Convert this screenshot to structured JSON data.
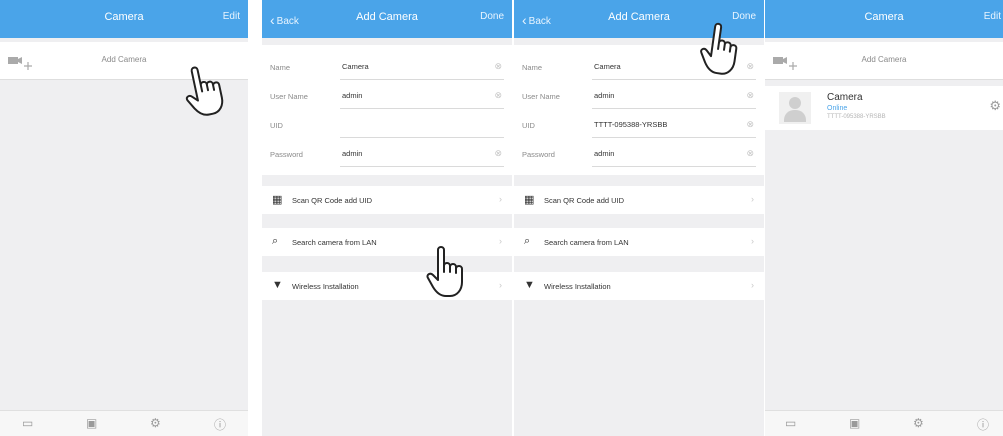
{
  "screen1": {
    "nav": {
      "title": "Camera",
      "edit": "Edit"
    },
    "add_camera_label": "Add Camera"
  },
  "screen2": {
    "nav": {
      "back": "Back",
      "title": "Add Camera",
      "done": "Done"
    },
    "form": [
      {
        "label": "Name",
        "value": "Camera"
      },
      {
        "label": "User Name",
        "value": "admin"
      },
      {
        "label": "UID",
        "value": ""
      },
      {
        "label": "Password",
        "value": "admin"
      }
    ],
    "options": [
      {
        "icon": "qr-code-icon",
        "label": "Scan QR Code add UID"
      },
      {
        "icon": "search-icon",
        "label": "Search camera from LAN"
      },
      {
        "icon": "wifi-icon",
        "label": "Wireless Installation"
      }
    ]
  },
  "screen3": {
    "nav": {
      "back": "Back",
      "title": "Add Camera",
      "done": "Done"
    },
    "form": [
      {
        "label": "Name",
        "value": "Camera"
      },
      {
        "label": "User Name",
        "value": "admin"
      },
      {
        "label": "UID",
        "value": "TTTT-095388-YRSBB"
      },
      {
        "label": "Password",
        "value": "admin"
      }
    ],
    "options": [
      {
        "icon": "qr-code-icon",
        "label": "Scan QR Code add UID"
      },
      {
        "icon": "search-icon",
        "label": "Search camera from LAN"
      },
      {
        "icon": "wifi-icon",
        "label": "Wireless Installation"
      }
    ]
  },
  "screen4": {
    "nav": {
      "title": "Camera",
      "edit": "Edit"
    },
    "add_camera_label": "Add Camera",
    "device": {
      "name": "Camera",
      "status": "Online",
      "uid": "TTTT-095388-YRSBB"
    }
  },
  "colors": {
    "navbar": "#4aa4e9",
    "background": "#efeff1",
    "online": "#4aa4e9"
  },
  "icons": {
    "tabbar": [
      "video-icon",
      "image-icon",
      "settings-icon",
      "info-icon"
    ],
    "clear": "clear-circle-icon",
    "gear": "gear-icon",
    "hand": "pointing-hand-icon"
  }
}
